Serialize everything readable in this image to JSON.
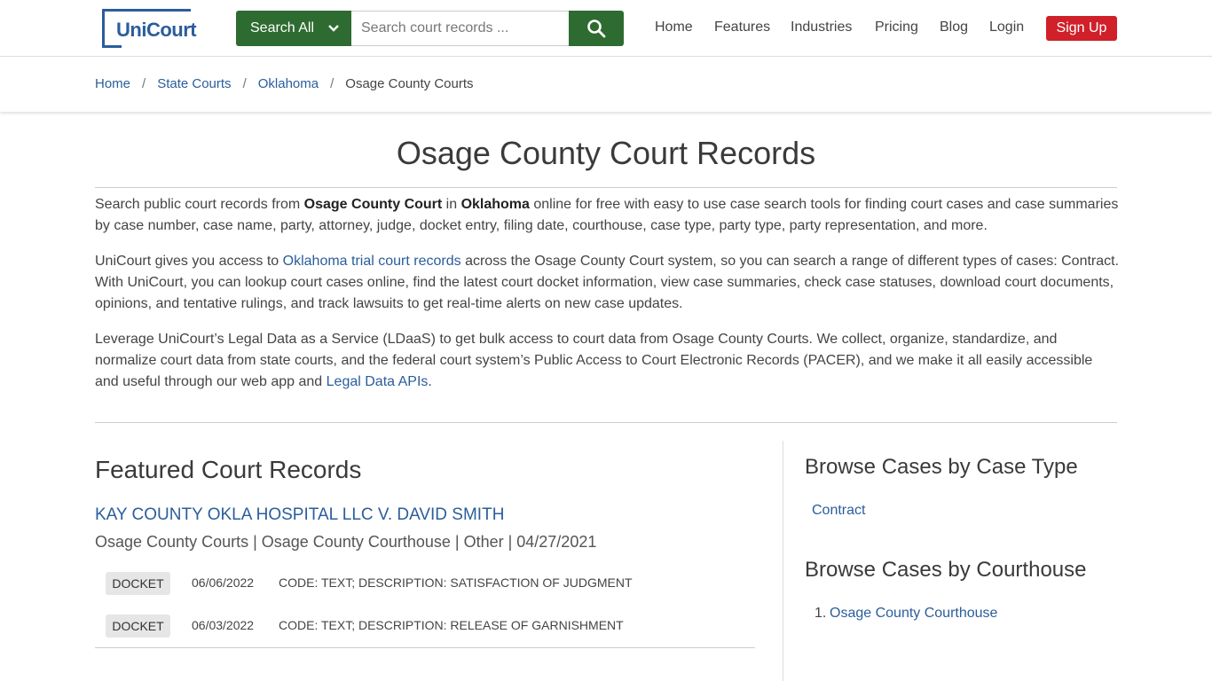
{
  "header": {
    "logo_text": "UniCourt",
    "search_all_label": "Search All",
    "search_placeholder": "Search court records ...",
    "nav": [
      "Home",
      "Features",
      "Industries",
      "Pricing",
      "Blog",
      "Login"
    ],
    "signup_label": "Sign Up"
  },
  "breadcrumb": {
    "items": [
      "Home",
      "State Courts",
      "Oklahoma"
    ],
    "separator": "/",
    "current": "Osage County Courts"
  },
  "page": {
    "title": "Osage County Court Records",
    "para1": {
      "t1": "Search public court records from ",
      "b1": "Osage County Court",
      "t2": " in ",
      "b2": "Oklahoma",
      "t3": " online for free with easy to use case search tools for finding court cases and case summaries by case number, case name, party, attorney, judge, docket entry, filing date, courthouse, case type, party type, party representation, and more."
    },
    "para2": {
      "t1": "UniCourt gives you access to ",
      "link": "Oklahoma trial court records",
      "t2": " across the Osage County Court system, so you can search a range of different types of cases: Contract. With UniCourt, you can lookup court cases online, find the latest court docket information, view case summaries, check case statuses, download court documents, opinions, and tentative rulings, and track lawsuits to get real-time alerts on new case updates."
    },
    "para3": {
      "t1": "Leverage UniCourt’s Legal Data as a Service (LDaaS) to get bulk access to court data from Osage County Courts. We collect, organize, standardize, and normalize court data from state courts, and the federal court system’s Public Access to Court Electronic Records (PACER), and we make it all easily accessible and useful through our web app and ",
      "link": "Legal Data APIs",
      "t2": "."
    }
  },
  "featured": {
    "heading": "Featured Court Records",
    "case_title": "KAY COUNTY OKLA HOSPITAL LLC V. DAVID SMITH",
    "case_meta": "Osage County Courts | Osage County Courthouse | Other | 04/27/2021",
    "dockets": [
      {
        "badge": "DOCKET",
        "date": "06/06/2022",
        "desc": "CODE: TEXT; DESCRIPTION: SATISFACTION OF JUDGMENT"
      },
      {
        "badge": "DOCKET",
        "date": "06/03/2022",
        "desc": "CODE: TEXT; DESCRIPTION: RELEASE OF GARNISHMENT"
      }
    ]
  },
  "sidebar": {
    "case_type_heading": "Browse Cases by Case Type",
    "case_types": [
      "Contract"
    ],
    "courthouse_heading": "Browse Cases by Courthouse",
    "courthouses": [
      {
        "num": "1.",
        "name": "Osage County Courthouse"
      }
    ]
  },
  "colors": {
    "brand_blue": "#2b5d9b",
    "search_green": "#2e6b30",
    "signup_red": "#d0202a"
  }
}
